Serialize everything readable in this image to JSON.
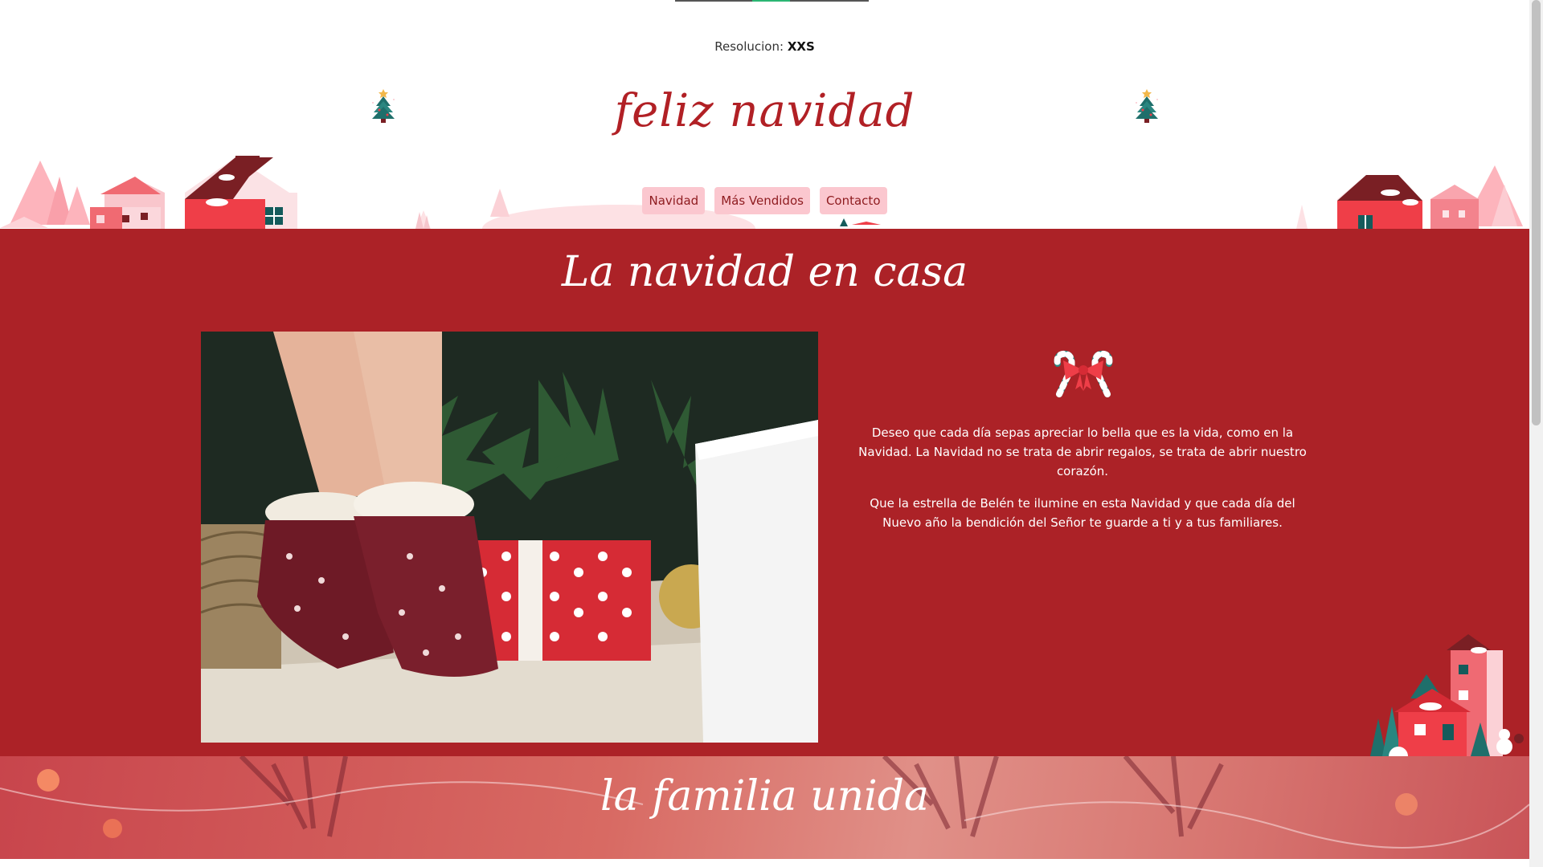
{
  "resolution": {
    "label": "Resolucion:",
    "value": "XXS"
  },
  "header": {
    "title": "feliz navidad",
    "icons": [
      "christmas-tree-icon",
      "christmas-tree-icon"
    ],
    "nav": [
      "Navidad",
      "Más Vendidos",
      "Contacto"
    ]
  },
  "section_red": {
    "heading": "La navidad en casa",
    "photo": "socks-and-gifts-photo",
    "ornament": "candy-cane-bow-icon",
    "paragraphs": [
      "Deseo que cada día sepas apreciar lo bella que es la vida, como en la Navidad. La Navidad no se trata de abrir regalos, se trata de abrir nuestro corazón.",
      "Que la estrella de Belén te ilumine en esta Navidad y que cada día del Nuevo año la bendición del Señor te guarde a ti y a tus familiares."
    ]
  },
  "section_bottom": {
    "heading": "la familia unida"
  },
  "colors": {
    "brand_red": "#ac2227",
    "title_red": "#b12025",
    "nav_pink": "#fbc7cf",
    "white": "#ffffff"
  }
}
